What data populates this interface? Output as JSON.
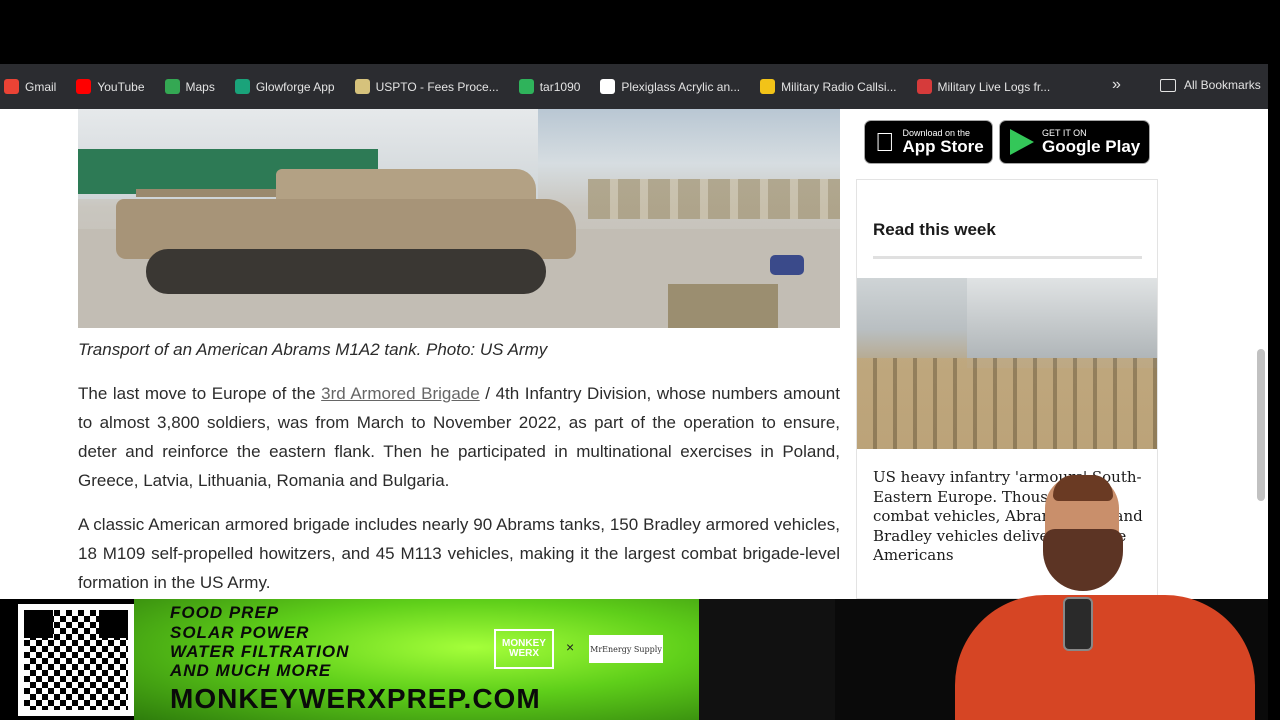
{
  "bookmarks": {
    "items": [
      {
        "label": "Gmail",
        "icon": "gmail-icon",
        "color": "#ea4335"
      },
      {
        "label": "YouTube",
        "icon": "youtube-icon",
        "color": "#ff0000"
      },
      {
        "label": "Maps",
        "icon": "maps-icon",
        "color": "#34a853"
      },
      {
        "label": "Glowforge App",
        "icon": "glowforge-icon",
        "color": "#1aa37a"
      },
      {
        "label": "USPTO - Fees Proce...",
        "icon": "uspto-icon",
        "color": "#d6c27c"
      },
      {
        "label": "tar1090",
        "icon": "tar1090-icon",
        "color": "#2fb35b"
      },
      {
        "label": "Plexiglass Acrylic an...",
        "icon": "esp-icon",
        "color": "#ffffff"
      },
      {
        "label": "Military Radio Callsi...",
        "icon": "bookmark-icon",
        "color": "#f2c318"
      },
      {
        "label": "Military Live Logs fr...",
        "icon": "shield-icon",
        "color": "#d63b3b"
      }
    ],
    "more_glyph": "»",
    "all_label": "All Bookmarks"
  },
  "article": {
    "caption": "Transport of an American Abrams M1A2 tank. Photo: US Army",
    "para1_before": "The last move to Europe of the ",
    "para1_link": "3rd Armored Brigade",
    "para1_after": " / 4th Infantry Division, whose numbers amount to almost 3,800 soldiers, was from March to November 2022, as part of the operation to ensure, deter and reinforce the eastern flank. Then he participated in multinational exercises in Poland, Greece, Latvia, Lithuania, Romania and Bulgaria.",
    "para2": "A classic American armored brigade includes nearly 90 Abrams tanks, 150 Bradley armored vehicles, 18 M109 self-propelled howitzers, and 45 M113 vehicles, making it the largest combat brigade-level formation in the US Army."
  },
  "sidebar": {
    "app_store_small": "Download on the",
    "app_store_big": "App Store",
    "play_small": "GET IT ON",
    "play_big": "Google Play",
    "read_title": "Read this week",
    "read_story": "US heavy infantry 'armours' South-Eastern Europe. Thousands of combat vehicles, Abrams tanks and Bradley vehicles delivered by the Americans"
  },
  "ad": {
    "line1": "FOOD PREP",
    "line2": "SOLAR POWER",
    "line3": "WATER FILTRATION",
    "line4": "AND MUCH MORE",
    "url": "MONKEYWERXPREP.COM",
    "logo1": "MONKEY WERX",
    "x": "×",
    "logo2": "MrEnergy Supply"
  }
}
